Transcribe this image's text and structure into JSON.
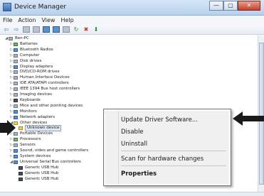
{
  "window": {
    "title": "Device Manager",
    "buttons": {
      "minimize": "—",
      "maximize": "▢",
      "close": "✕"
    }
  },
  "menubar": [
    "File",
    "Action",
    "View",
    "Help"
  ],
  "toolbar": {
    "back": "⇦",
    "forward": "⇨"
  },
  "tree": [
    {
      "label": "Ben-PC",
      "level": 0,
      "exp": "◢"
    },
    {
      "label": "Batteries",
      "level": 1,
      "exp": "▷"
    },
    {
      "label": "Bluetooth Radios",
      "level": 1,
      "exp": "▷"
    },
    {
      "label": "Computer",
      "level": 1,
      "exp": "▷"
    },
    {
      "label": "Disk drives",
      "level": 1,
      "exp": "▷"
    },
    {
      "label": "Display adapters",
      "level": 1,
      "exp": "▷"
    },
    {
      "label": "DVD/CD-ROM drives",
      "level": 1,
      "exp": "▷"
    },
    {
      "label": "Human Interface Devices",
      "level": 1,
      "exp": "▷"
    },
    {
      "label": "IDE ATA/ATAPI controllers",
      "level": 1,
      "exp": "▷"
    },
    {
      "label": "IEEE 1394 Bus host controllers",
      "level": 1,
      "exp": "▷"
    },
    {
      "label": "Imaging devices",
      "level": 1,
      "exp": "▷"
    },
    {
      "label": "Keyboards",
      "level": 1,
      "exp": "▷"
    },
    {
      "label": "Mice and other pointing devices",
      "level": 1,
      "exp": "▷"
    },
    {
      "label": "Monitors",
      "level": 1,
      "exp": "▷"
    },
    {
      "label": "Network adapters",
      "level": 1,
      "exp": "▷"
    },
    {
      "label": "Other devices",
      "level": 1,
      "exp": "◢"
    },
    {
      "label": "Unknown device",
      "level": 2,
      "exp": ""
    },
    {
      "label": "Portable Devices",
      "level": 1,
      "exp": "▷"
    },
    {
      "label": "Processors",
      "level": 1,
      "exp": "▷"
    },
    {
      "label": "Sensors",
      "level": 1,
      "exp": "▷"
    },
    {
      "label": "Sound, video and game controllers",
      "level": 1,
      "exp": "▷"
    },
    {
      "label": "System devices",
      "level": 1,
      "exp": "▷"
    },
    {
      "label": "Universal Serial Bus controllers",
      "level": 1,
      "exp": "◢"
    },
    {
      "label": "Generic USB Hub",
      "level": 2,
      "exp": ""
    },
    {
      "label": "Generic USB Hub",
      "level": 2,
      "exp": ""
    },
    {
      "label": "Generic USB Hub",
      "level": 2,
      "exp": ""
    }
  ],
  "context_menu": {
    "update": "Update Driver Software...",
    "disable": "Disable",
    "uninstall": "Uninstall",
    "scan": "Scan for hardware changes",
    "properties": "Properties"
  },
  "colors": {
    "arrow": "#1a1a1a",
    "selection": "#dde8f7"
  }
}
